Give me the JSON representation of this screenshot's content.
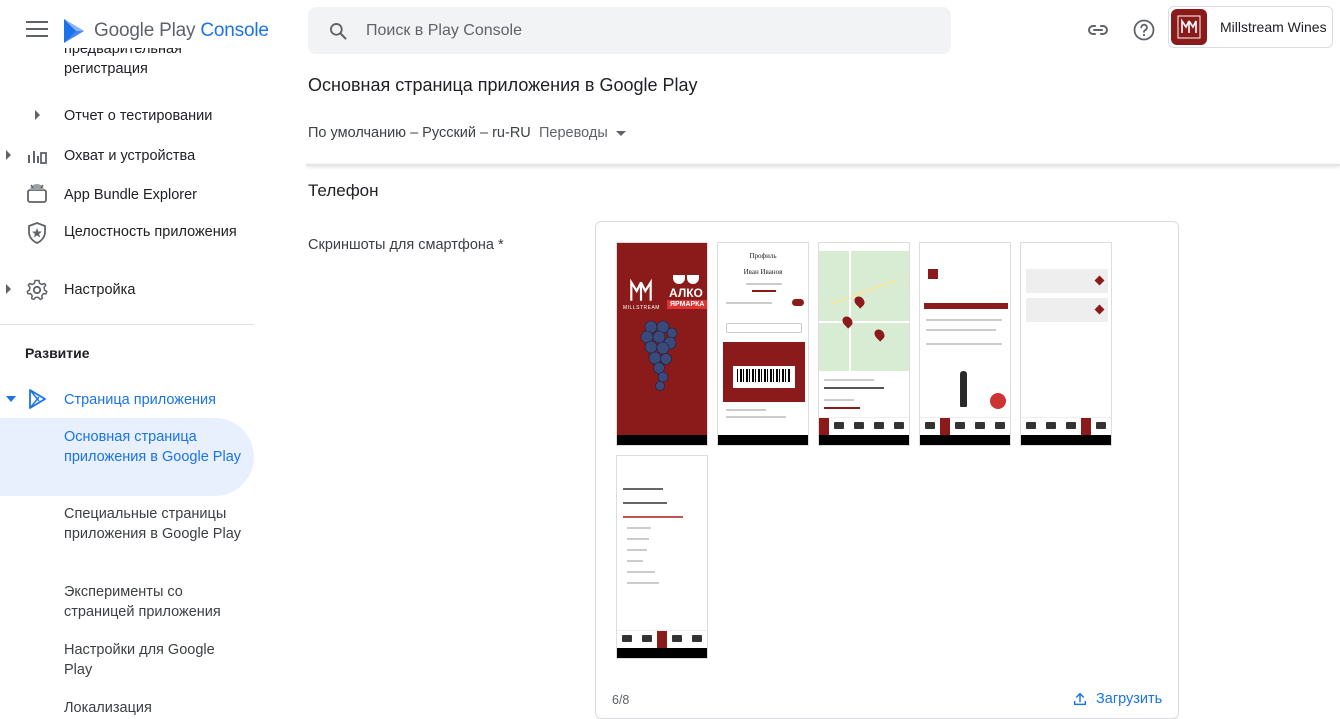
{
  "topbar": {
    "logo_google": "Google Play",
    "logo_console": "Console",
    "search_placeholder": "Поиск в Play Console",
    "account_name": "Millstream Wines"
  },
  "sidebar": {
    "items": [
      {
        "label": "предварительная регистрация",
        "icon": "none"
      },
      {
        "label": "Отчет о тестировании",
        "icon": "none"
      },
      {
        "label": "Охват и устройства",
        "icon": "bar-chart-icon"
      },
      {
        "label": "App Bundle Explorer",
        "icon": "android-icon"
      },
      {
        "label": "Целостность приложения",
        "icon": "shield-icon"
      },
      {
        "label": "Настройка",
        "icon": "gear-icon"
      }
    ],
    "section_title": "Развитие",
    "store_presence": {
      "label": "Страница приложения",
      "icon": "play-icon"
    },
    "sub_items": [
      {
        "label": "Основная страница приложения в Google Play",
        "active": true
      },
      {
        "label": "Специальные страницы приложения в Google Play",
        "active": false
      },
      {
        "label": "Эксперименты со страницей приложения",
        "active": false
      },
      {
        "label": "Настройки для Google Play",
        "active": false
      },
      {
        "label": "Локализация",
        "active": false
      }
    ]
  },
  "main": {
    "title": "Основная страница приложения в Google Play",
    "locale": "По умолчанию – Русский – ru-RU",
    "translations": "Переводы",
    "section": "Телефон",
    "field_label": "Скриншоты для смартфона",
    "required_mark": "*",
    "counter": "6/8",
    "upload": "Загрузить"
  },
  "screenshots": [
    {
      "name": "splash",
      "brand": "MILLSTREAM",
      "badge_top": "АЛКО",
      "badge_bottom": "ЯРМАРКА"
    },
    {
      "name": "profile",
      "title": "Профиль",
      "user": "Иван Иванов"
    },
    {
      "name": "map"
    },
    {
      "name": "catalog"
    },
    {
      "name": "orders"
    },
    {
      "name": "support"
    }
  ],
  "colors": {
    "accent": "#1a73e8",
    "brand": "#8b1a1a",
    "active_bg": "#e8f0fe"
  }
}
